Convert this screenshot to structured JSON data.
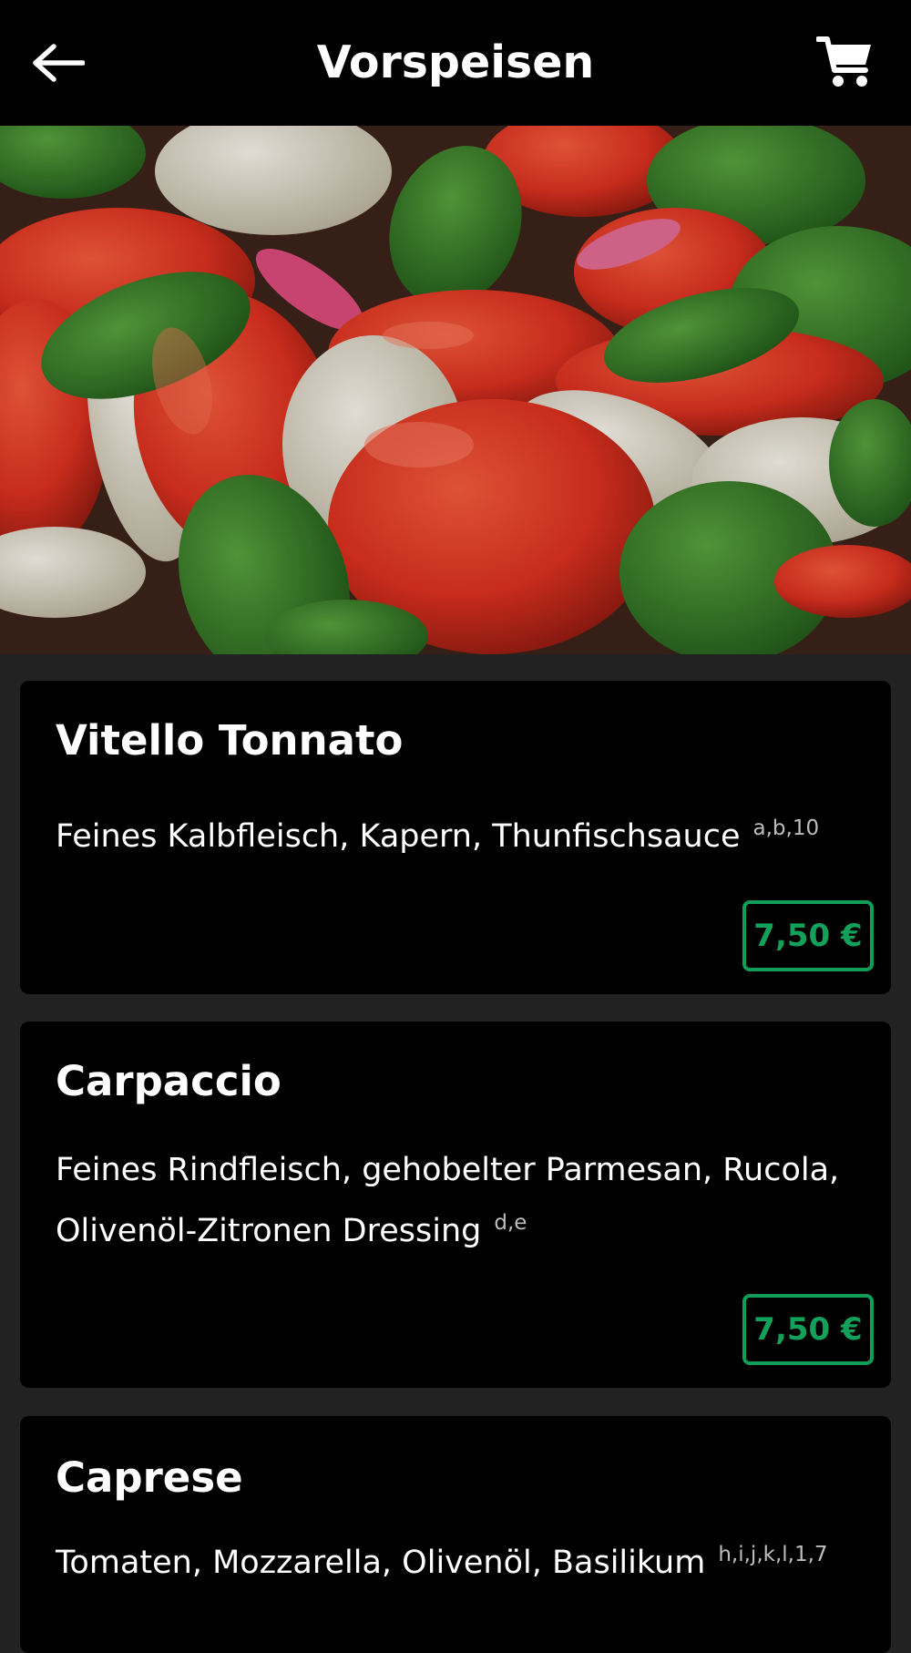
{
  "header": {
    "title": "Vorspeisen",
    "back_icon": "arrow-left-icon",
    "cart_icon": "shopping-cart-icon"
  },
  "colors": {
    "background": "#222222",
    "bar": "#000000",
    "price_accent": "#0f9d58"
  },
  "dishes": [
    {
      "name": "Vitello Tonnato",
      "description": "Feines Kalbfleisch, Kapern, Thunfischsauce",
      "allergens": "a,b,10",
      "price": "7,50 €"
    },
    {
      "name": "Carpaccio",
      "description": "Feines Rindfleisch, gehobelter Parmesan, Rucola, Olivenöl-Zitronen Dressing",
      "allergens": "d,e",
      "price": "7,50 €"
    },
    {
      "name": "Caprese",
      "description": "Tomaten, Mozzarella, Olivenöl, Basilikum",
      "allergens": "h,i,j,k,l,1,7"
    }
  ]
}
